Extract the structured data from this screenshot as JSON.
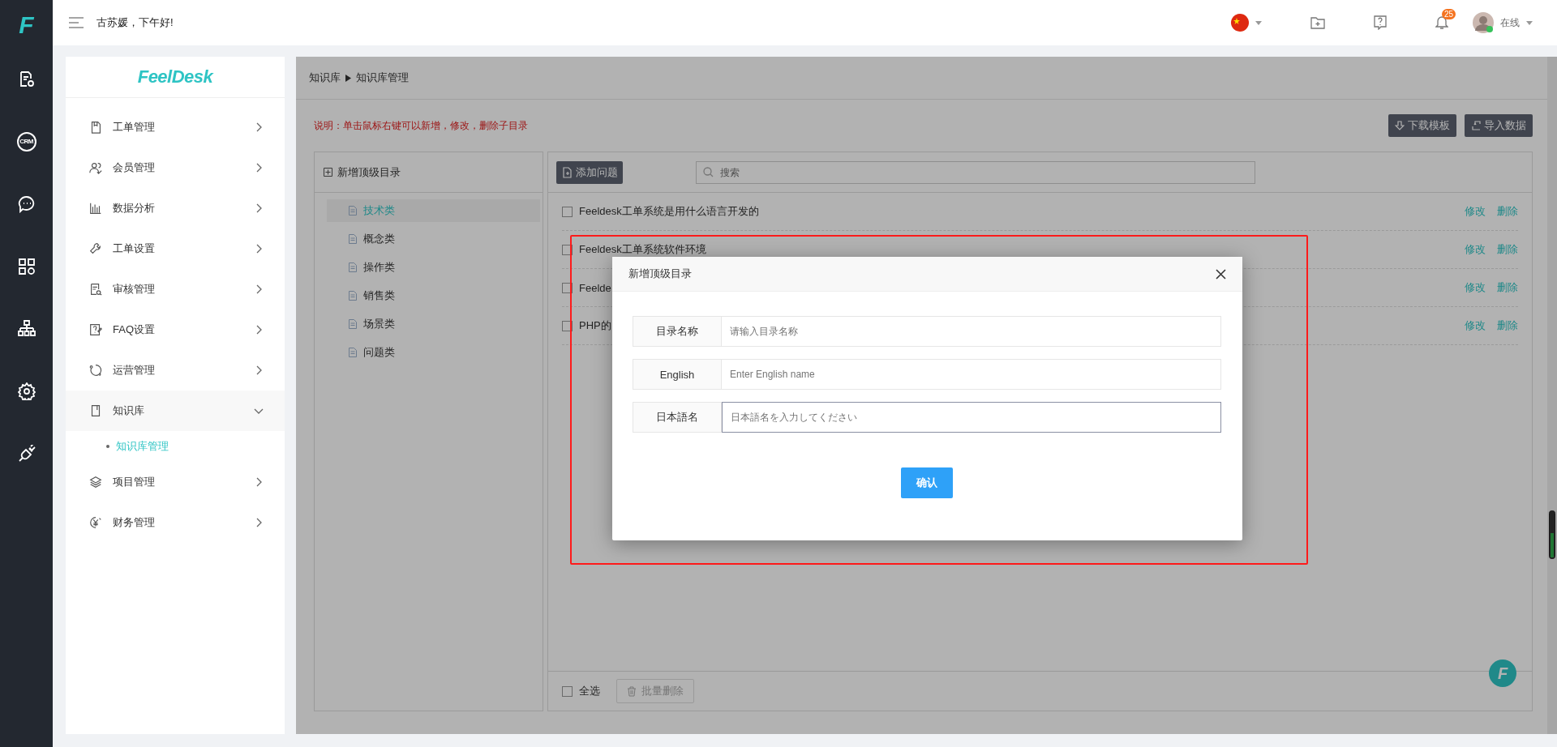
{
  "rail": {
    "logo": "F",
    "crm_label": "CRM"
  },
  "topbar": {
    "greeting": "古苏媛，下午好!",
    "notifications": "25",
    "status": "在线"
  },
  "sidebar": {
    "logo": "FeelDesk",
    "items": [
      {
        "label": "工单管理",
        "expanded": false
      },
      {
        "label": "会员管理",
        "expanded": false
      },
      {
        "label": "数据分析",
        "expanded": false
      },
      {
        "label": "工单设置",
        "expanded": false
      },
      {
        "label": "审核管理",
        "expanded": false
      },
      {
        "label": "FAQ设置",
        "expanded": false
      },
      {
        "label": "运营管理",
        "expanded": false
      },
      {
        "label": "知识库",
        "expanded": true,
        "children": [
          {
            "label": "知识库管理",
            "selected": true
          }
        ]
      },
      {
        "label": "项目管理",
        "expanded": false
      },
      {
        "label": "财务管理",
        "expanded": false
      }
    ]
  },
  "breadcrumb": [
    "知识库",
    "知识库管理"
  ],
  "note": "说明：单击鼠标右键可以新增，修改，删除子目录",
  "toolbar_buttons": [
    "下载模板",
    "导入数据"
  ],
  "tree": {
    "add_label": "新增顶级目录",
    "items": [
      {
        "label": "技术类",
        "selected": true
      },
      {
        "label": "概念类",
        "selected": false
      },
      {
        "label": "操作类",
        "selected": false
      },
      {
        "label": "销售类",
        "selected": false
      },
      {
        "label": "场景类",
        "selected": false
      },
      {
        "label": "问题类",
        "selected": false
      }
    ]
  },
  "questions": {
    "add_button": "添加问题",
    "search_placeholder": "搜索",
    "rows": [
      {
        "text": "Feeldesk工单系统是用什么语言开发的",
        "checked": false,
        "actions": [
          "修改",
          "删除"
        ]
      },
      {
        "text": "Feeldesk工单系统软件环境",
        "checked": false,
        "actions": [
          "修改",
          "删除"
        ]
      },
      {
        "text": "Feelde",
        "checked": false,
        "actions": [
          "修改",
          "删除"
        ]
      },
      {
        "text": "PHP的",
        "checked": false,
        "actions": [
          "修改",
          "删除"
        ]
      }
    ],
    "select_all": {
      "label": "全选",
      "checked": false
    },
    "batch_delete": {
      "label": "批量删除",
      "disabled": true
    }
  },
  "float_logo": "F",
  "dialog": {
    "title": "新增顶级目录",
    "fields": [
      {
        "label": "目录名称",
        "placeholder": "请输入目录名称",
        "focused": false
      },
      {
        "label": "English",
        "placeholder": "Enter English name",
        "focused": false
      },
      {
        "label": "日本語名",
        "placeholder": "日本語名を入力してください",
        "focused": true
      }
    ],
    "confirm": "确认"
  }
}
